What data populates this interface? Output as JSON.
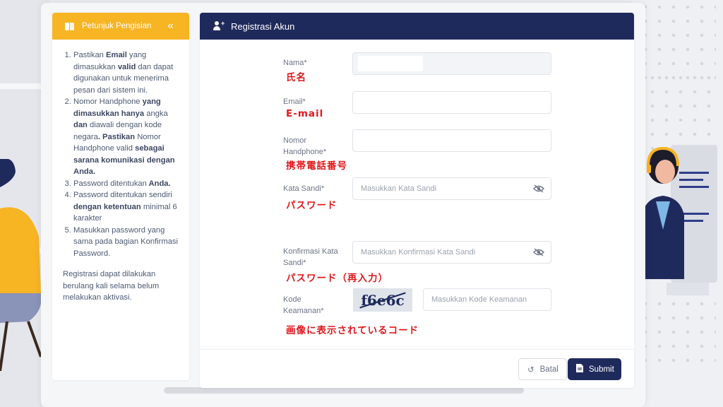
{
  "guide": {
    "title": "Petunjuk Pengisian",
    "collapse_icon": "chevrons-left-icon",
    "items": [
      [
        "Pastikan ",
        "Email",
        " yang dimasukkan ",
        "valid",
        " dan dapat digunakan untuk menerima pesan dari sistem ini."
      ],
      [
        "Nomor Handphone",
        " yang dimasukkan hanya ",
        "angka",
        " dan ",
        "diawali dengan kode negara",
        ". Pastikan ",
        "Nomor Handphone valid",
        " sebagai sarana komunikasi dengan Anda."
      ],
      [
        "Password ditentukan",
        " Anda."
      ],
      [
        "Password ditentukan sendiri",
        " dengan ketentuan ",
        "minimal 6 karakter",
        ""
      ],
      [
        "Masukkan password yang sama pada bagian Konfirmasi Password."
      ]
    ],
    "note": "Registrasi dapat dilakukan berulang kali selama belum melakukan aktivasi."
  },
  "form": {
    "title": "Registrasi Akun",
    "nama_label": "Nama*",
    "email_label": "Email*",
    "phone_label_1": "Nomor",
    "phone_label_2": "Handphone*",
    "password_label": "Kata Sandi*",
    "password_placeholder": "Masukkan Kata Sandi",
    "confirm_label_1": "Konfirmasi Kata",
    "confirm_label_2": "Sandi*",
    "confirm_placeholder": "Masukkan Konfirmasi Kata Sandi",
    "code_label_1": "Kode",
    "code_label_2": "Keamanan*",
    "captcha_text": "f6e6c",
    "code_placeholder": "Masukkan Kode Keamanan",
    "cancel_label": "Batal",
    "submit_label": "Submit"
  },
  "annotations": {
    "nama": "氏名",
    "email": "E-mail",
    "phone": "携帯電話番号",
    "password": "パスワード",
    "confirm": "パスワード（再入力）",
    "code": "画像に表示されているコード"
  },
  "colors": {
    "header_navy": "#1f2a5c",
    "guide_orange": "#f7b423",
    "annotation_red": "#e0181b"
  }
}
